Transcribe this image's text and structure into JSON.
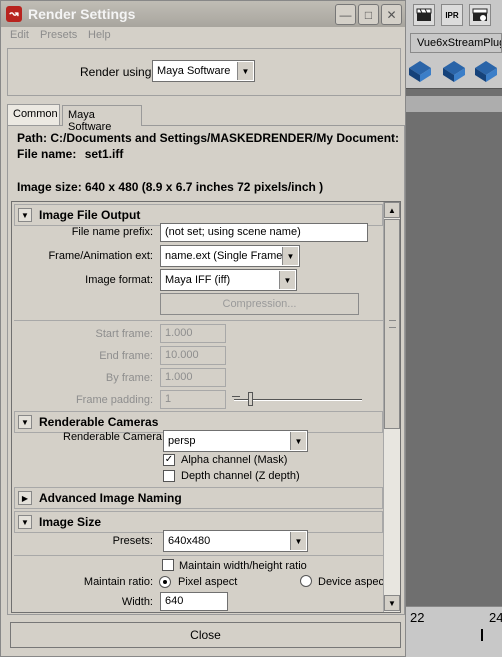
{
  "window": {
    "title": "Render Settings",
    "menu": [
      "Edit",
      "Presets",
      "Help"
    ]
  },
  "render_using": {
    "label": "Render using:",
    "value": "Maya Software"
  },
  "tabs": [
    {
      "label": "Common",
      "active": true
    },
    {
      "label": "Maya Software",
      "active": false
    }
  ],
  "info": {
    "path": "Path: C:/Documents and Settings/MASKEDRENDER/My Document:",
    "file_label": "File name:",
    "file_value": "set1.iff",
    "image_size": "Image size: 640 x 480 (8.9 x 6.7 inches 72 pixels/inch )"
  },
  "image_file_output": {
    "title": "Image File Output",
    "prefix_label": "File name prefix:",
    "prefix_value": "(not set; using scene name)",
    "ext_label": "Frame/Animation ext:",
    "ext_value": "name.ext (Single Frame)",
    "format_label": "Image format:",
    "format_value": "Maya IFF (iff)",
    "compression_label": "Compression...",
    "start_label": "Start frame:",
    "start_value": "1.000",
    "end_label": "End frame:",
    "end_value": "10.000",
    "by_label": "By frame:",
    "by_value": "1.000",
    "padding_label": "Frame padding:",
    "padding_value": "1"
  },
  "renderable_cameras": {
    "title": "Renderable Cameras",
    "camera_label": "Renderable Camera",
    "camera_value": "persp",
    "alpha_label": "Alpha channel (Mask)",
    "alpha_checked": true,
    "depth_label": "Depth channel (Z depth)",
    "depth_checked": false
  },
  "advanced_naming": {
    "title": "Advanced Image Naming"
  },
  "image_size": {
    "title": "Image Size",
    "presets_label": "Presets:",
    "presets_value": "640x480",
    "maintain_wh_label": "Maintain width/height ratio",
    "maintain_ratio_label": "Maintain ratio:",
    "pixel_aspect_label": "Pixel aspect",
    "device_aspect_label": "Device aspec",
    "width_label": "Width:",
    "width_value": "640"
  },
  "close_label": "Close",
  "background": {
    "shelf_tab": "Vue6xStreamPlug",
    "ipr_label": "IPR",
    "timeline_left": "22",
    "timeline_right": "24"
  }
}
